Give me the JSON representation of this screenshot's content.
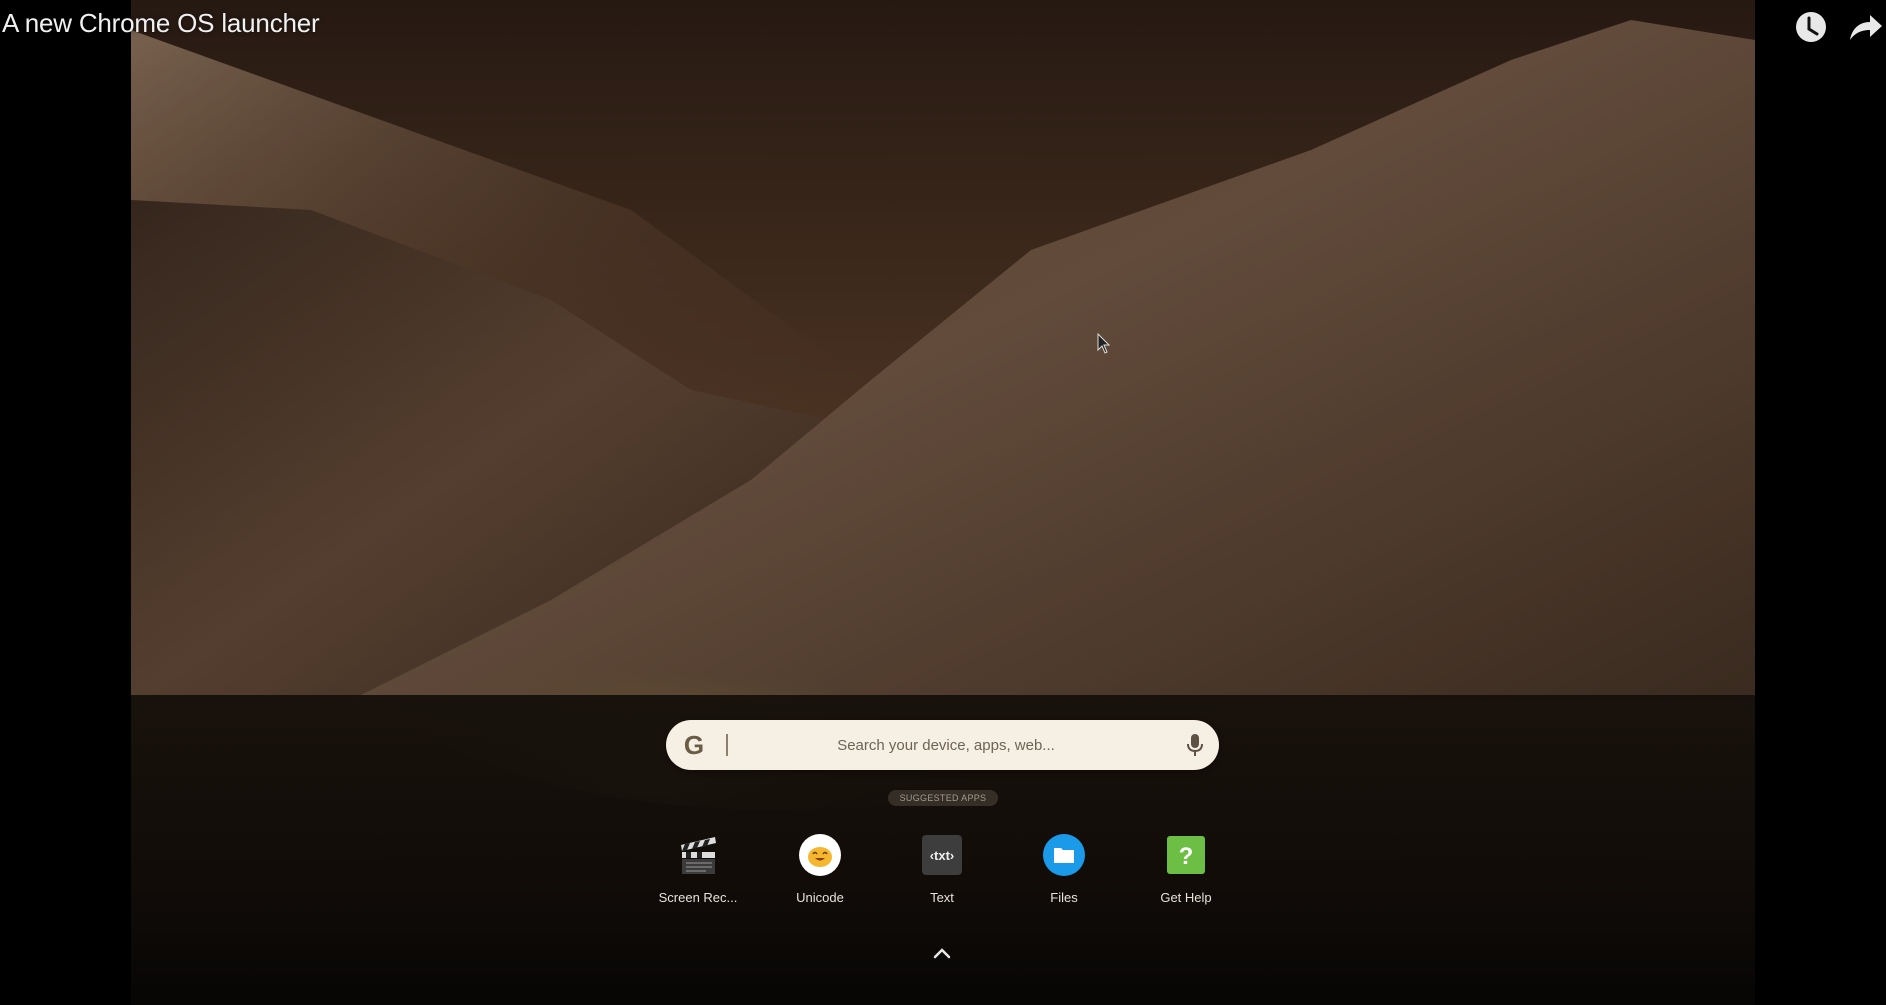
{
  "video": {
    "title": "A new Chrome OS launcher",
    "controls": [
      {
        "name": "watch-later",
        "icon": "clock-icon"
      },
      {
        "name": "share",
        "icon": "share-arrow-icon"
      }
    ]
  },
  "launcher": {
    "search": {
      "logo": "G",
      "value": "",
      "placeholder": "Search your device, apps, web...",
      "mic_icon": "microphone-icon"
    },
    "suggested_label": "SUGGESTED APPS",
    "apps": [
      {
        "label": "Screen Rec...",
        "icon": "clapperboard-icon"
      },
      {
        "label": "Unicode",
        "icon": "emoji-blob-icon"
      },
      {
        "label": "Text",
        "icon": "txt-editor-icon"
      },
      {
        "label": "Files",
        "icon": "folder-icon"
      },
      {
        "label": "Get Help",
        "icon": "help-question-icon"
      }
    ],
    "expand_icon": "chevron-up-icon"
  },
  "colors": {
    "search_bg": "#f6efe3",
    "files_blue": "#1a9ae8",
    "help_green": "#6cbf44",
    "text_dark": "#3d3d3d",
    "unicode_yellow": "#f5b72f"
  }
}
